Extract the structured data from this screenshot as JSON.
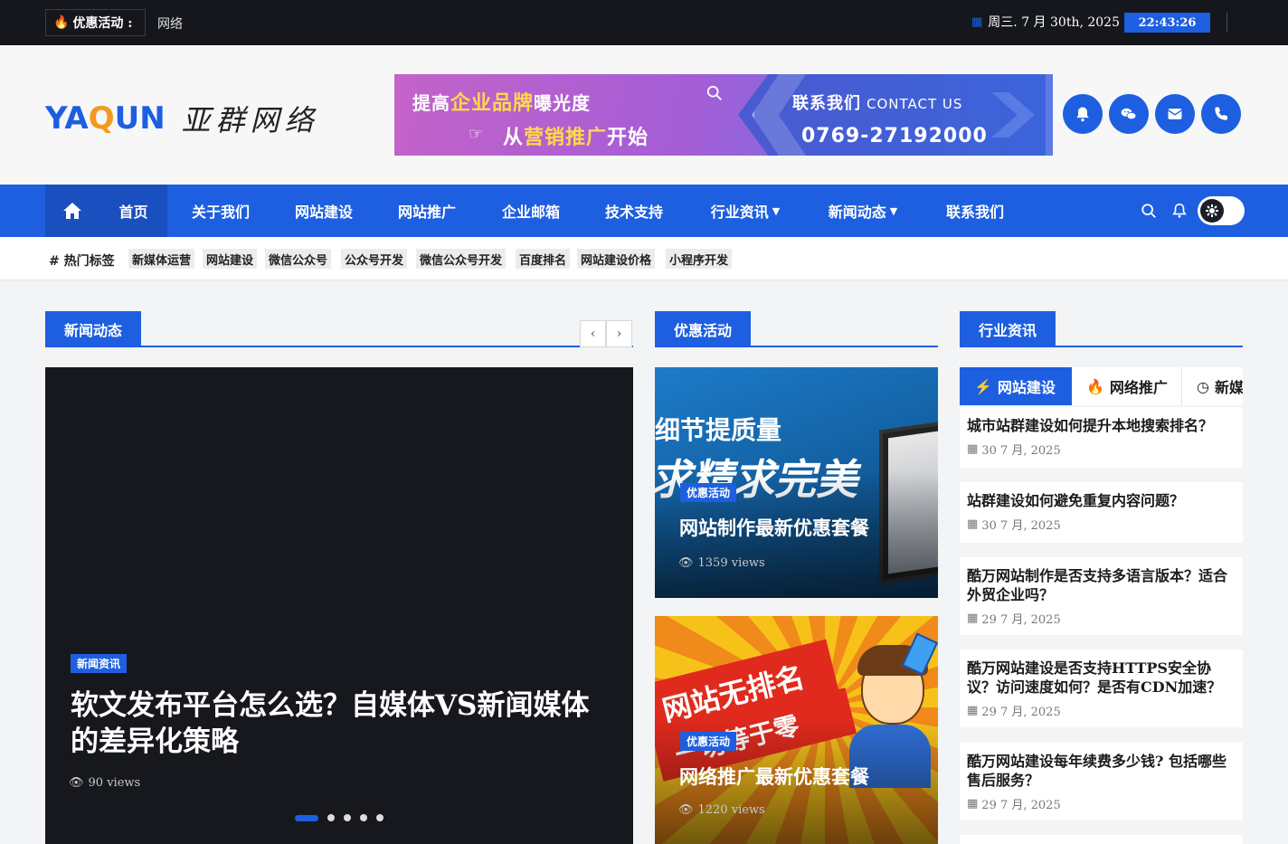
{
  "topbar": {
    "promo_label": "优惠活动 :",
    "ticker_text": "网络",
    "date": "周三. 7 月 30th, 2025",
    "time": "22:43:26"
  },
  "header": {
    "logo_en_left": "YA",
    "logo_en_q": "Q",
    "logo_en_right": "UN",
    "logo_cn": "亚群网络",
    "banner": {
      "line1_a": "提高",
      "line1_hl": "企业品牌",
      "line1_b": "曝光度",
      "line2_a": "从",
      "line2_hl": "营销推广",
      "line2_b": "开始",
      "contact_cn": "联系我们",
      "contact_en": "CONTACT US",
      "phone": "0769-27192000"
    },
    "social_icons": [
      "bell-icon",
      "wechat-icon",
      "mail-icon",
      "phone-icon"
    ]
  },
  "nav": {
    "items": [
      {
        "label": "首页",
        "dropdown": false
      },
      {
        "label": "关于我们",
        "dropdown": false
      },
      {
        "label": "网站建设",
        "dropdown": false
      },
      {
        "label": "网站推广",
        "dropdown": false
      },
      {
        "label": "企业邮箱",
        "dropdown": false
      },
      {
        "label": "技术支持",
        "dropdown": false
      },
      {
        "label": "行业资讯",
        "dropdown": true
      },
      {
        "label": "新闻动态",
        "dropdown": true
      },
      {
        "label": "联系我们",
        "dropdown": false
      }
    ],
    "active_index": 0
  },
  "tags": {
    "title": "# 热门标签",
    "items": [
      "新媒体运营",
      "网站建设",
      "微信公众号",
      "公众号开发",
      "微信公众号开发",
      "百度排名",
      "网站建设价格",
      "小程序开发"
    ]
  },
  "news_section": {
    "heading": "新闻动态",
    "slide": {
      "category": "新闻资讯",
      "title": "软文发布平台怎么选？自媒体VS新闻媒体的差异化策略",
      "views": "90 views"
    },
    "dot_count": 5,
    "active_dot": 0
  },
  "promo_section": {
    "heading": "优惠活动",
    "cards": [
      {
        "category": "优惠活动",
        "title": "网站制作最新优惠套餐",
        "views": "1359 views",
        "art_line1": "细节提质量",
        "art_line2": "求精求完美"
      },
      {
        "category": "优惠活动",
        "title": "网络推广最新优惠套餐",
        "views": "1220 views",
        "art_line1": "网站无排名",
        "art_line2": "一切等于零"
      }
    ]
  },
  "industry_section": {
    "heading": "行业资讯",
    "tabs": [
      {
        "label": "网站建设",
        "icon": "bolt-icon"
      },
      {
        "label": "网络推广",
        "icon": "fire-icon"
      },
      {
        "label": "新媒",
        "icon": "clock-icon"
      }
    ],
    "posts": [
      {
        "title": "城市站群建设如何提升本地搜索排名？",
        "date": "30 7 月, 2025"
      },
      {
        "title": "站群建设如何避免重复内容问题？",
        "date": "30 7 月, 2025"
      },
      {
        "title": "酷万网站制作是否支持多语言版本？适合外贸企业吗？",
        "date": "29 7 月, 2025"
      },
      {
        "title": "酷万网站建设是否支持HTTPS安全协议？访问速度如何？是否有CDN加速？",
        "date": "29 7 月, 2025"
      },
      {
        "title": "酷万网站建设每年续费多少钱? 包括哪些售后服务？",
        "date": "29 7 月, 2025"
      }
    ]
  }
}
